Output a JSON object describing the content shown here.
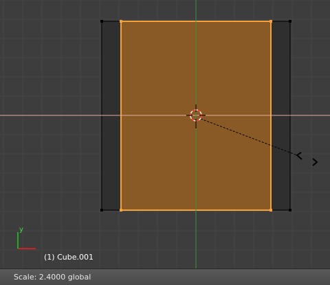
{
  "viewport": {
    "object_label": "(1) Cube.001",
    "axis_label_y": "y",
    "colors": {
      "background": "#3d3d3d",
      "grid_line": "#454545",
      "x_axis": "#e8a9a0",
      "y_axis": "#3f8f3f",
      "selected_face": "#8a5a26",
      "selected_edge": "#f5a23c",
      "side_face": "#2f2f2f",
      "cursor_red": "#ff3030",
      "widget_x": "#cc2222",
      "widget_y": "#22aa22"
    }
  },
  "status_bar": {
    "text": "Scale: 2.4000 global"
  }
}
